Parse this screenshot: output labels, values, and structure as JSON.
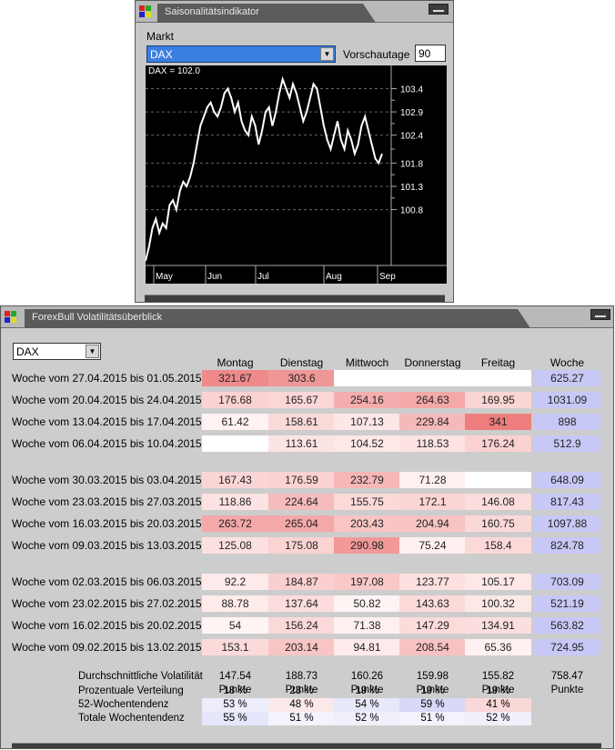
{
  "seasonal": {
    "title": "Saisonalitätsindikator",
    "markt_label": "Markt",
    "markt_value": "DAX",
    "vorschau_label": "Vorschautage",
    "vorschau_value": "90",
    "chart_label": "DAX = 102.0"
  },
  "chart_data": {
    "type": "line",
    "series": [
      {
        "name": "DAX",
        "values": [
          99.7,
          100.0,
          100.4,
          100.6,
          100.3,
          100.5,
          100.4,
          100.9,
          101.0,
          100.8,
          101.2,
          101.4,
          101.3,
          101.5,
          101.8,
          102.2,
          102.6,
          102.8,
          103.0,
          103.1,
          102.9,
          102.8,
          103.0,
          103.3,
          103.4,
          103.2,
          102.9,
          103.1,
          102.7,
          102.5,
          102.4,
          102.8,
          102.6,
          102.2,
          102.5,
          102.9,
          103.0,
          102.6,
          102.9,
          103.3,
          103.6,
          103.4,
          103.2,
          103.5,
          103.3,
          103.0,
          102.7,
          102.9,
          103.2,
          103.5,
          103.4,
          103.0,
          102.6,
          102.3,
          102.1,
          102.4,
          102.7,
          102.3,
          102.1,
          102.5,
          102.3,
          102.0,
          102.2,
          102.6,
          102.8,
          102.5,
          102.2,
          101.9,
          101.8,
          102.0
        ]
      }
    ],
    "y_ticks": [
      "103.4",
      "102.9",
      "102.4",
      "101.8",
      "101.3",
      "100.8"
    ],
    "y_tick_values": [
      103.4,
      102.9,
      102.4,
      101.8,
      101.3,
      100.8
    ],
    "ylim": [
      99.6,
      103.8
    ],
    "x_months": [
      "May",
      "Jun",
      "Jul",
      "Aug",
      "Sep"
    ],
    "grid": true
  },
  "vol": {
    "title": "ForexBull Volatilitätsüberblick",
    "market": "DAX",
    "headers": [
      "Montag",
      "Dienstag",
      "Mittwoch",
      "Donnerstag",
      "Freitag",
      "Woche"
    ],
    "rows": [
      {
        "label": "Woche vom 27.04.2015 bis 01.05.2015",
        "v": [
          "321.67",
          "303.6",
          "",
          "",
          "",
          ""
        ],
        "wk": "625.27",
        "c": [
          "#ee8a8a",
          "#ef9696",
          "#ffffff",
          "#ffffff",
          "#ffffff"
        ]
      },
      {
        "label": "Woche vom 20.04.2015 bis 24.04.2015",
        "v": [
          "176.68",
          "165.67",
          "254.16",
          "264.63",
          "169.95"
        ],
        "wk": "1031.09",
        "c": [
          "#fbd2d2",
          "#fbd6d6",
          "#f5adad",
          "#f4a8a8",
          "#fbd4d4"
        ]
      },
      {
        "label": "Woche vom 13.04.2015 bis 17.04.2015",
        "v": [
          "61.42",
          "158.61",
          "107.13",
          "229.84",
          "341"
        ],
        "wk": "898",
        "c": [
          "#fff2f2",
          "#fbd9d9",
          "#fde6e6",
          "#f6b9b9",
          "#ee7e7e"
        ]
      },
      {
        "label": "Woche vom 06.04.2015 bis 10.04.2015",
        "v": [
          "",
          "113.61",
          "104.52",
          "118.53",
          "176.24"
        ],
        "wk": "512.9",
        "c": [
          "#ffffff",
          "#fde4e4",
          "#fde7e7",
          "#fce2e2",
          "#fbd2d2"
        ]
      },
      {
        "label": "Woche vom 30.03.2015 bis 03.04.2015",
        "v": [
          "167.43",
          "176.59",
          "232.79",
          "71.28",
          ""
        ],
        "wk": "648.09",
        "c": [
          "#fbd5d5",
          "#fbd2d2",
          "#f6b7b7",
          "#fff0f0",
          "#ffffff"
        ]
      },
      {
        "label": "Woche vom 23.03.2015 bis 27.03.2015",
        "v": [
          "118.86",
          "224.64",
          "155.75",
          "172.1",
          "146.08"
        ],
        "wk": "817.43",
        "c": [
          "#fce2e2",
          "#f6bbbb",
          "#fbd9d9",
          "#fbd4d4",
          "#fcdcdc"
        ]
      },
      {
        "label": "Woche vom 16.03.2015 bis 20.03.2015",
        "v": [
          "263.72",
          "265.04",
          "203.43",
          "204.94",
          "160.75"
        ],
        "wk": "1097.88",
        "c": [
          "#f4a8a8",
          "#f4a8a8",
          "#f8c4c4",
          "#f8c3c3",
          "#fbd8d8"
        ]
      },
      {
        "label": "Woche vom 09.03.2015 bis 13.03.2015",
        "v": [
          "125.08",
          "175.08",
          "290.98",
          "75.24",
          "158.4"
        ],
        "wk": "824.78",
        "c": [
          "#fce0e0",
          "#fbd3d3",
          "#f29999",
          "#ffefef",
          "#fbd9d9"
        ]
      },
      {
        "label": "Woche vom 02.03.2015 bis 06.03.2015",
        "v": [
          "92.2",
          "184.87",
          "197.08",
          "123.77",
          "105.17"
        ],
        "wk": "703.09",
        "c": [
          "#feeaea",
          "#facfcf",
          "#f9c8c8",
          "#fce0e0",
          "#fde7e7"
        ]
      },
      {
        "label": "Woche vom 23.02.2015 bis 27.02.2015",
        "v": [
          "88.78",
          "137.64",
          "50.82",
          "143.63",
          "100.32"
        ],
        "wk": "521.19",
        "c": [
          "#feebeb",
          "#fcdcdc",
          "#fff4f4",
          "#fcdada",
          "#fde8e8"
        ]
      },
      {
        "label": "Woche vom 16.02.2015 bis 20.02.2015",
        "v": [
          "54",
          "156.24",
          "71.38",
          "147.29",
          "134.91"
        ],
        "wk": "563.82",
        "c": [
          "#fff4f4",
          "#fbd9d9",
          "#fff0f0",
          "#fcdbdb",
          "#fcdede"
        ]
      },
      {
        "label": "Woche vom 09.02.2015 bis 13.02.2015",
        "v": [
          "153.1",
          "203.14",
          "94.81",
          "208.54",
          "65.36"
        ],
        "wk": "724.95",
        "c": [
          "#fbdada",
          "#f8c4c4",
          "#feeaea",
          "#f8c2c2",
          "#fff1f1"
        ]
      }
    ],
    "summary": [
      {
        "label": "Durchschnittliche Volatilität",
        "v": [
          "147.54 Punkte",
          "188.73 Punkte",
          "160.26 Punkte",
          "159.98 Punkte",
          "155.82 Punkte",
          "758.47 Punkte"
        ],
        "c": [
          "",
          "",
          "",
          "",
          "",
          ""
        ]
      },
      {
        "label": "Prozentuale Verteilung",
        "v": [
          "18 %",
          "23 %",
          "19 %",
          "19 %",
          "19 %",
          ""
        ],
        "c": [
          "",
          "",
          "",
          "",
          "",
          ""
        ]
      },
      {
        "label": "52-Wochentendenz",
        "v": [
          "53 %",
          "48 %",
          "54 %",
          "59 %",
          "41 %",
          ""
        ],
        "c": [
          "#ececfb",
          "#fbe8e8",
          "#e8e8fb",
          "#d8d8f8",
          "#fad8d8",
          ""
        ]
      },
      {
        "label": "Totale Wochentendenz",
        "v": [
          "55 %",
          "51 %",
          "52 %",
          "51 %",
          "52 %",
          ""
        ],
        "c": [
          "#e6e6fa",
          "#f3f3fc",
          "#f0f0fb",
          "#f3f3fc",
          "#f0f0fb",
          ""
        ]
      }
    ],
    "week_color": "#c8c8f6"
  }
}
